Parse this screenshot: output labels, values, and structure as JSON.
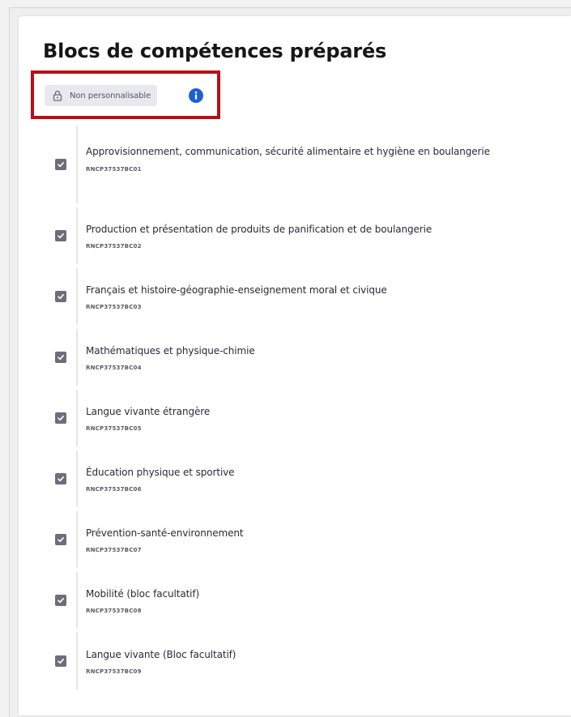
{
  "section": {
    "title": "Blocs de compétences préparés",
    "badge_label": "Non personnalisable"
  },
  "colors": {
    "highlight": "#b80f17",
    "info": "#1f5fd6",
    "checkbox": "#6e6e7a"
  },
  "icons": {
    "badge": "lock-icon",
    "info": "info-icon",
    "checkbox": "checkmark-icon"
  },
  "blocks": [
    {
      "label": "Approvisionnement, communication, sécurité alimentaire et hygiène en boulangerie",
      "code": "RNCP37537BC01",
      "checked": true
    },
    {
      "label": "Production et présentation de produits de panification et de boulangerie",
      "code": "RNCP37537BC02",
      "checked": true
    },
    {
      "label": "Français et histoire-géographie-enseignement moral et civique",
      "code": "RNCP37537BC03",
      "checked": true
    },
    {
      "label": "Mathématiques et physique-chimie",
      "code": "RNCP37537BC04",
      "checked": true
    },
    {
      "label": "Langue vivante étrangère",
      "code": "RNCP37537BC05",
      "checked": true
    },
    {
      "label": "Éducation physique et sportive",
      "code": "RNCP37537BC06",
      "checked": true
    },
    {
      "label": "Prévention-santé-environnement",
      "code": "RNCP37537BC07",
      "checked": true
    },
    {
      "label": "Mobilité (bloc facultatif)",
      "code": "RNCP37537BC08",
      "checked": true
    },
    {
      "label": "Langue vivante (Bloc facultatif)",
      "code": "RNCP37537BC09",
      "checked": true
    }
  ]
}
